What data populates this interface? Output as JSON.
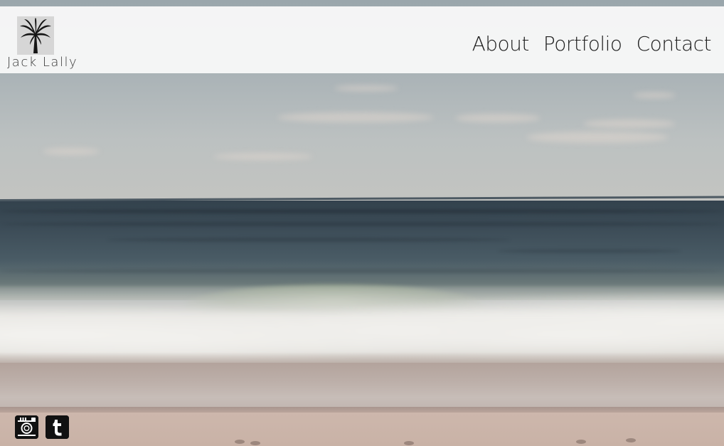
{
  "site": {
    "logo_text": "Jack Lally",
    "logo_icon": "palm-tree-icon"
  },
  "nav": {
    "items": [
      {
        "label": "About"
      },
      {
        "label": "Portfolio"
      },
      {
        "label": "Contact"
      }
    ]
  },
  "social": {
    "items": [
      {
        "icon": "instagram-icon"
      },
      {
        "icon": "tumblr-icon"
      }
    ]
  },
  "colors": {
    "header_bg": "#f7f7f7",
    "nav_text": "#1e1e1e",
    "icon_bg": "#111111"
  }
}
